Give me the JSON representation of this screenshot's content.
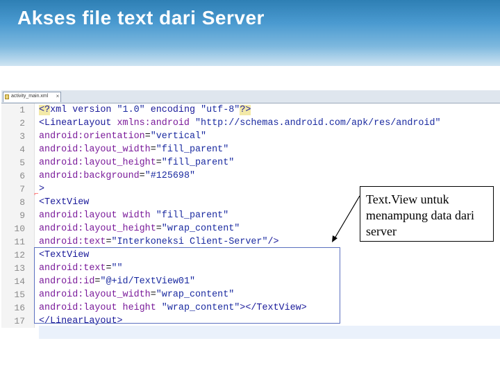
{
  "slide": {
    "title": "Akses file text dari Server"
  },
  "editor": {
    "tab_label": "activity_main.xml",
    "tab_close": "×",
    "lines": [
      {
        "number": "1",
        "tokens": [
          [
            "pi",
            "<?"
          ],
          [
            "tag",
            "xml version "
          ],
          [
            "val",
            "\"1.0\""
          ],
          [
            "tag",
            " encoding "
          ],
          [
            "val",
            "\"utf-8\""
          ],
          [
            "pi",
            "?>"
          ]
        ]
      },
      {
        "number": "2",
        "tokens": [
          [
            "tag",
            "<LinearLayout "
          ],
          [
            "attr",
            "xmlns:android "
          ],
          [
            "val",
            "\"http://schemas.android.com/apk/res/android\""
          ]
        ]
      },
      {
        "number": "3",
        "tokens": [
          [
            "attr",
            "android:orientation"
          ],
          [
            "plain",
            "="
          ],
          [
            "val",
            "\"vertical\""
          ]
        ]
      },
      {
        "number": "4",
        "tokens": [
          [
            "attr",
            "android:layout_width"
          ],
          [
            "plain",
            "="
          ],
          [
            "val",
            "\"fill_parent\""
          ]
        ]
      },
      {
        "number": "5",
        "tokens": [
          [
            "attr",
            "android:layout_height"
          ],
          [
            "plain",
            "="
          ],
          [
            "val",
            "\"fill_parent\""
          ]
        ]
      },
      {
        "number": "6",
        "tokens": [
          [
            "attr",
            "android:background"
          ],
          [
            "plain",
            "="
          ],
          [
            "val",
            "\"#125698\""
          ]
        ]
      },
      {
        "number": "7",
        "tokens": [
          [
            "tag",
            ">"
          ]
        ]
      },
      {
        "number": "8",
        "tokens": [
          [
            "tag",
            "<TextView"
          ]
        ]
      },
      {
        "number": "9",
        "tokens": [
          [
            "attr",
            "android:layout width "
          ],
          [
            "val",
            "\"fill_parent\""
          ]
        ]
      },
      {
        "number": "10",
        "tokens": [
          [
            "attr",
            "android:layout_height"
          ],
          [
            "plain",
            "="
          ],
          [
            "val",
            "\"wrap_content\""
          ]
        ]
      },
      {
        "number": "11",
        "tokens": [
          [
            "attr",
            "android:text"
          ],
          [
            "plain",
            "="
          ],
          [
            "val",
            "\"Interkoneksi Client-Server\""
          ],
          [
            "tag",
            "/>"
          ]
        ]
      },
      {
        "number": "12",
        "tokens": [
          [
            "tag",
            "<TextView"
          ]
        ]
      },
      {
        "number": "13",
        "tokens": [
          [
            "attr",
            "android:text"
          ],
          [
            "plain",
            "="
          ],
          [
            "val",
            "\"\""
          ]
        ]
      },
      {
        "number": "14",
        "tokens": [
          [
            "attr",
            "android:id"
          ],
          [
            "plain",
            "="
          ],
          [
            "val",
            "\"@+id/TextView01\""
          ]
        ]
      },
      {
        "number": "15",
        "tokens": [
          [
            "attr",
            "android:layout_width"
          ],
          [
            "plain",
            "="
          ],
          [
            "val",
            "\"wrap_content\""
          ]
        ]
      },
      {
        "number": "16",
        "tokens": [
          [
            "attr",
            "android:layout height "
          ],
          [
            "val",
            "\"wrap_content\""
          ],
          [
            "tag",
            "></TextView>"
          ]
        ]
      },
      {
        "number": "17",
        "tokens": [
          [
            "tag",
            "</LinearLayout>"
          ]
        ]
      }
    ]
  },
  "callout": {
    "text": "Text.View untuk menampung data dari server"
  },
  "colors": {
    "header_top": "#2e7fb4",
    "callout_border": "#000000",
    "selection_border": "#5a6fbf"
  }
}
